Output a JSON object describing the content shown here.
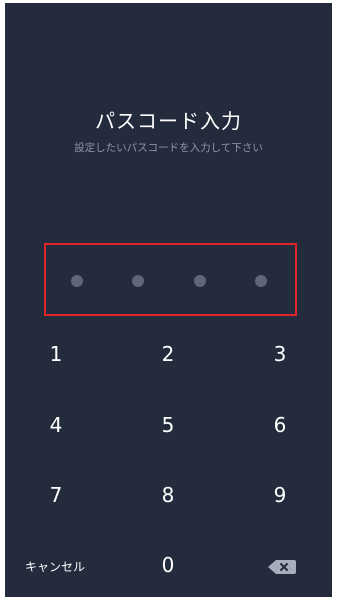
{
  "passcode": {
    "title": "パスコード入力",
    "subtitle": "設定したいパスコードを入力して下さい",
    "entered_digits": 0,
    "total_digits": 4
  },
  "keypad": {
    "keys": [
      "1",
      "2",
      "3",
      "4",
      "5",
      "6",
      "7",
      "8",
      "9",
      "0"
    ],
    "cancel_label": "キャンセル",
    "delete_icon": "backspace-icon"
  },
  "colors": {
    "background": "#242b3c",
    "highlight_border": "#e0242b",
    "dot": "#60667a",
    "subtitle": "#8d94a6"
  }
}
